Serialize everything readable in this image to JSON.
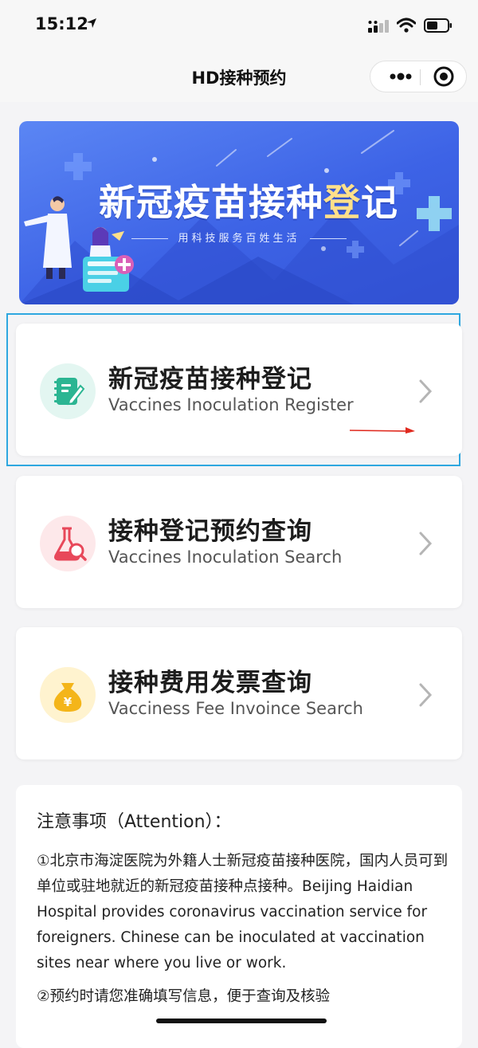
{
  "status_bar": {
    "time": "15:12"
  },
  "nav": {
    "title": "HD接种预约"
  },
  "banner": {
    "title_main": "新冠疫苗接种",
    "title_accent": "登",
    "title_end": "记",
    "subtitle": "用科技服务百姓生活"
  },
  "menu": [
    {
      "cn": "新冠疫苗接种登记",
      "en": "Vaccines Inoculation Register",
      "icon": "notebook-pen-icon",
      "icon_bg": "#e3f6f1",
      "icon_color": "#2bb592"
    },
    {
      "cn": "接种登记预约查询",
      "en": "Vaccines Inoculation Search",
      "icon": "flask-search-icon",
      "icon_bg": "#fde8ea",
      "icon_color": "#e8485a"
    },
    {
      "cn": "接种费用发票查询",
      "en": "Vacciness Fee Invoince Search",
      "icon": "money-bag-icon",
      "icon_bg": "#fff3cf",
      "icon_color": "#f4b519"
    }
  ],
  "attention": {
    "title": "注意事项（Attention）：",
    "items": [
      "①北京市海淀医院为外籍人士新冠疫苗接种医院，国内人员可到单位或驻地就近的新冠疫苗接种点接种。Beijing Haidian Hospital provides coronavirus vaccination service for foreigners. Chinese can be inoculated at vaccination sites near where you live or work.",
      "②预约时请您准确填写信息，便于查询及核验"
    ]
  },
  "colors": {
    "highlight_border": "#2ea7e0",
    "arrow": "#e02a1f",
    "banner_blue": "#3d63e6"
  }
}
